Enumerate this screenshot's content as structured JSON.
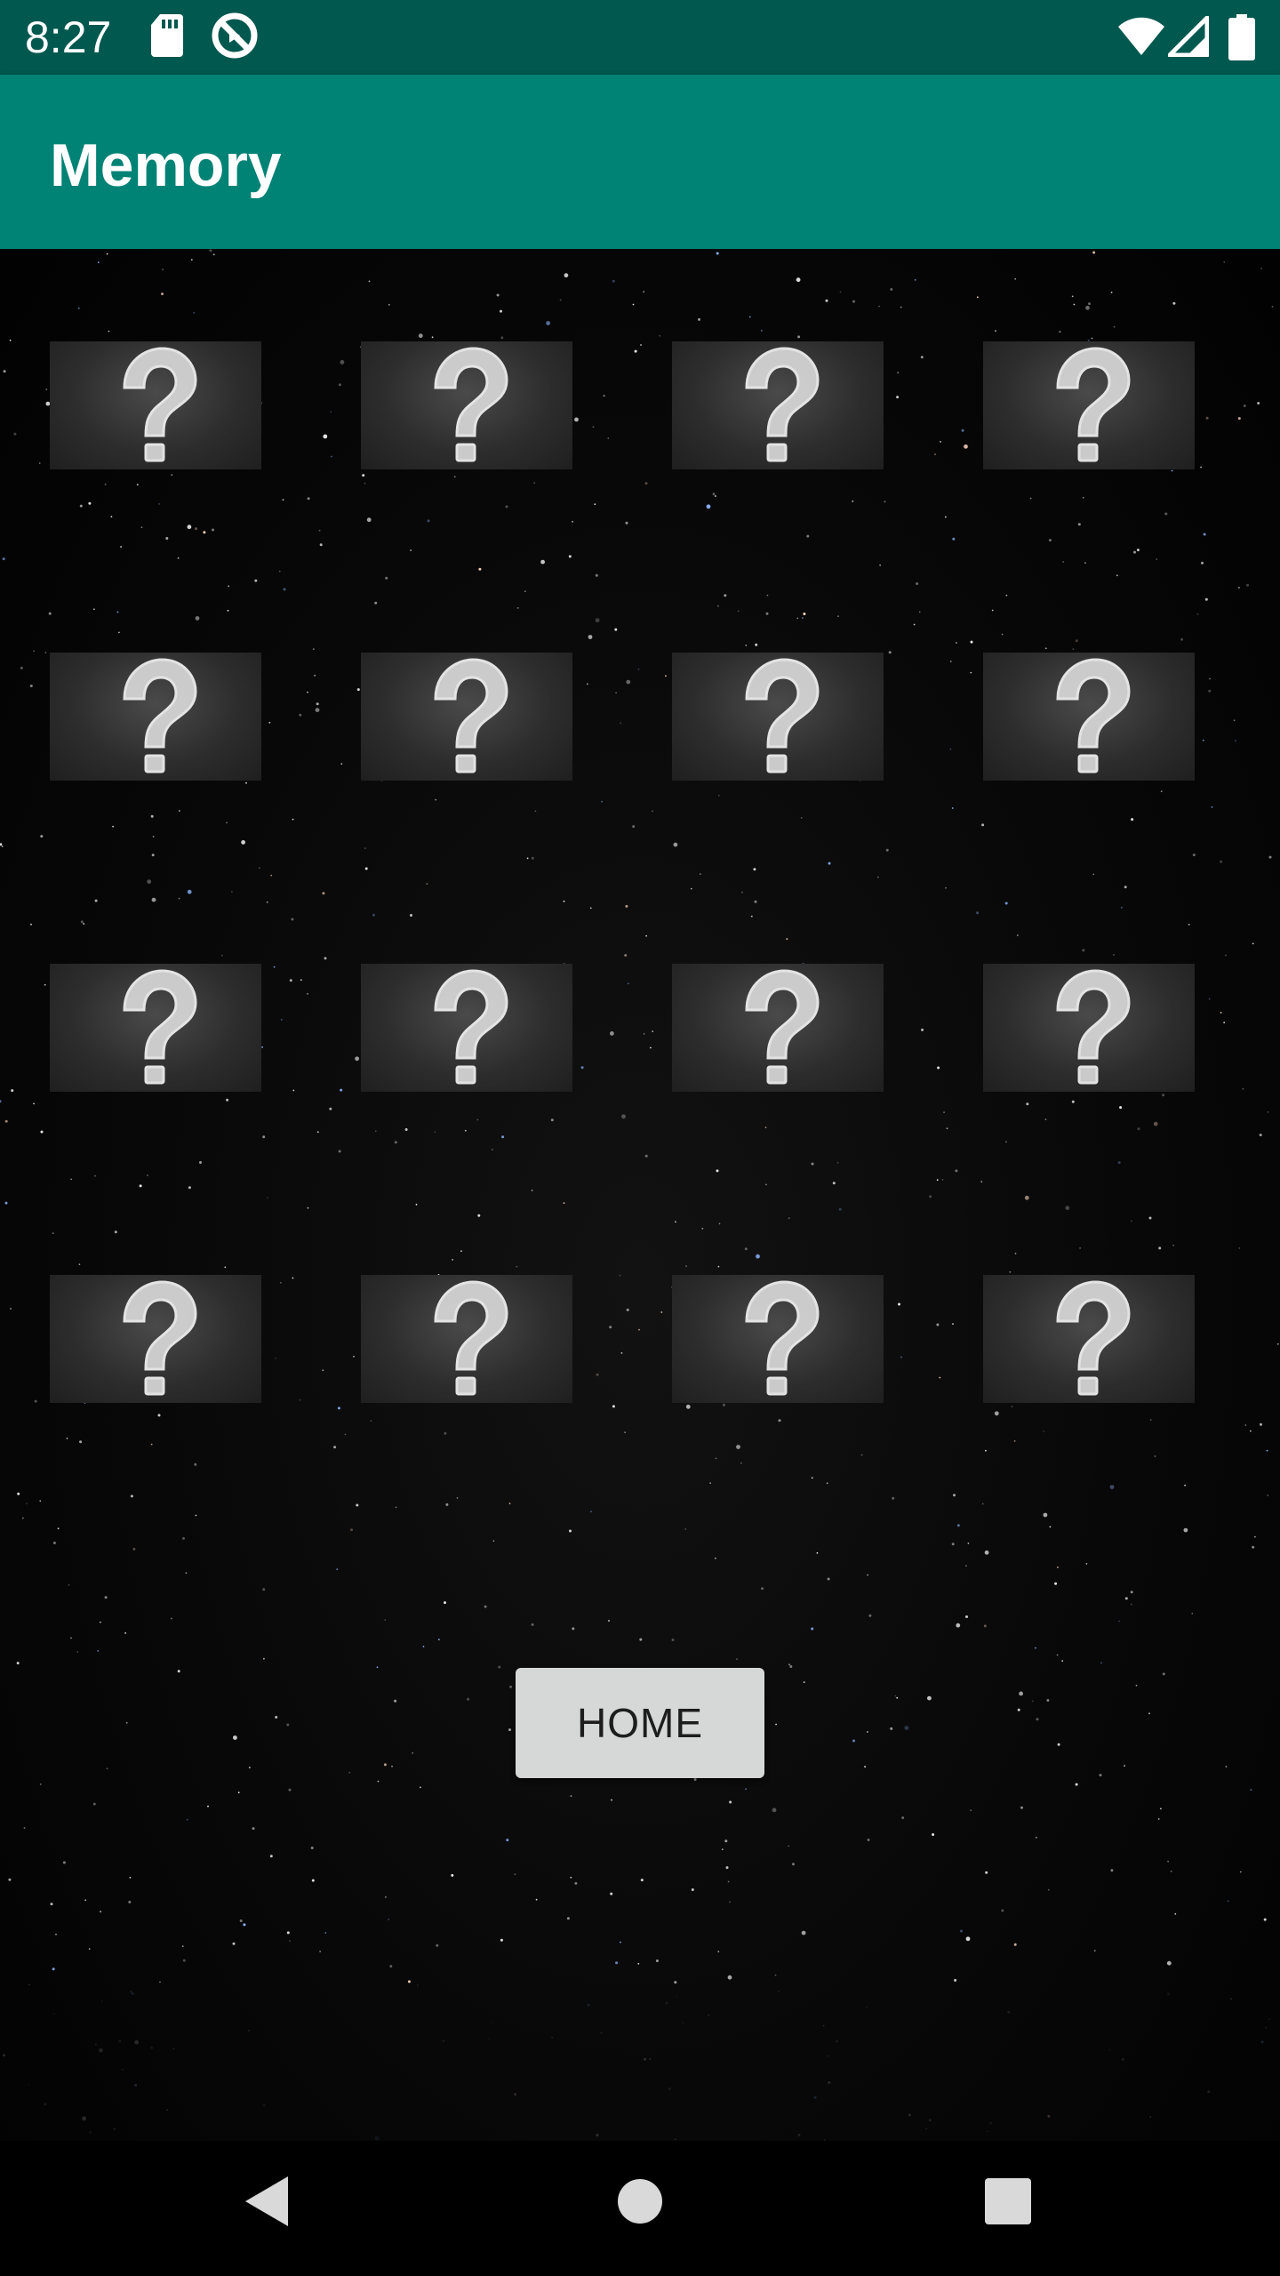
{
  "status_bar": {
    "time": "8:27",
    "icons": [
      "sd-card-icon",
      "sync-disabled-icon",
      "wifi-icon",
      "cellular-signal-icon",
      "battery-icon"
    ]
  },
  "app_bar": {
    "title": "Memory",
    "color": "#008275"
  },
  "game": {
    "cards": [
      {
        "state": "face-down",
        "symbol": "?"
      },
      {
        "state": "face-down",
        "symbol": "?"
      },
      {
        "state": "face-down",
        "symbol": "?"
      },
      {
        "state": "face-down",
        "symbol": "?"
      },
      {
        "state": "face-down",
        "symbol": "?"
      },
      {
        "state": "face-down",
        "symbol": "?"
      },
      {
        "state": "face-down",
        "symbol": "?"
      },
      {
        "state": "face-down",
        "symbol": "?"
      },
      {
        "state": "face-down",
        "symbol": "?"
      },
      {
        "state": "face-down",
        "symbol": "?"
      },
      {
        "state": "face-down",
        "symbol": "?"
      },
      {
        "state": "face-down",
        "symbol": "?"
      },
      {
        "state": "face-down",
        "symbol": "?"
      },
      {
        "state": "face-down",
        "symbol": "?"
      },
      {
        "state": "face-down",
        "symbol": "?"
      },
      {
        "state": "face-down",
        "symbol": "?"
      }
    ],
    "home_button_label": "HOME"
  },
  "nav_bar": {
    "buttons": [
      "back-icon",
      "home-circle-icon",
      "recents-square-icon"
    ]
  }
}
